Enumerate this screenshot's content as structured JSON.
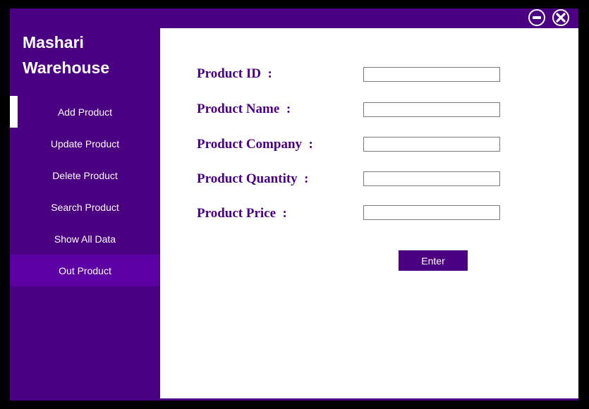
{
  "app": {
    "title_line1": "Mashari",
    "title_line2": "Warehouse"
  },
  "window_controls": {
    "minimize_icon": "minimize-circle-icon",
    "close_icon": "close-circle-icon"
  },
  "sidebar": {
    "items": [
      {
        "label": "Add Product"
      },
      {
        "label": "Update Product"
      },
      {
        "label": "Delete Product"
      },
      {
        "label": "Search Product"
      },
      {
        "label": "Show All Data"
      },
      {
        "label": "Out Product"
      }
    ]
  },
  "form": {
    "fields": [
      {
        "label": "Product ID  :",
        "value": ""
      },
      {
        "label": "Product Name  :",
        "value": ""
      },
      {
        "label": "Product Company  :",
        "value": ""
      },
      {
        "label": "Product Quantity  :",
        "value": ""
      },
      {
        "label": "Product Price  :",
        "value": ""
      }
    ],
    "submit_label": "Enter"
  },
  "colors": {
    "accent": "#4b0082",
    "sidebar_highlight": "#5c00a3",
    "frame": "#000000"
  }
}
